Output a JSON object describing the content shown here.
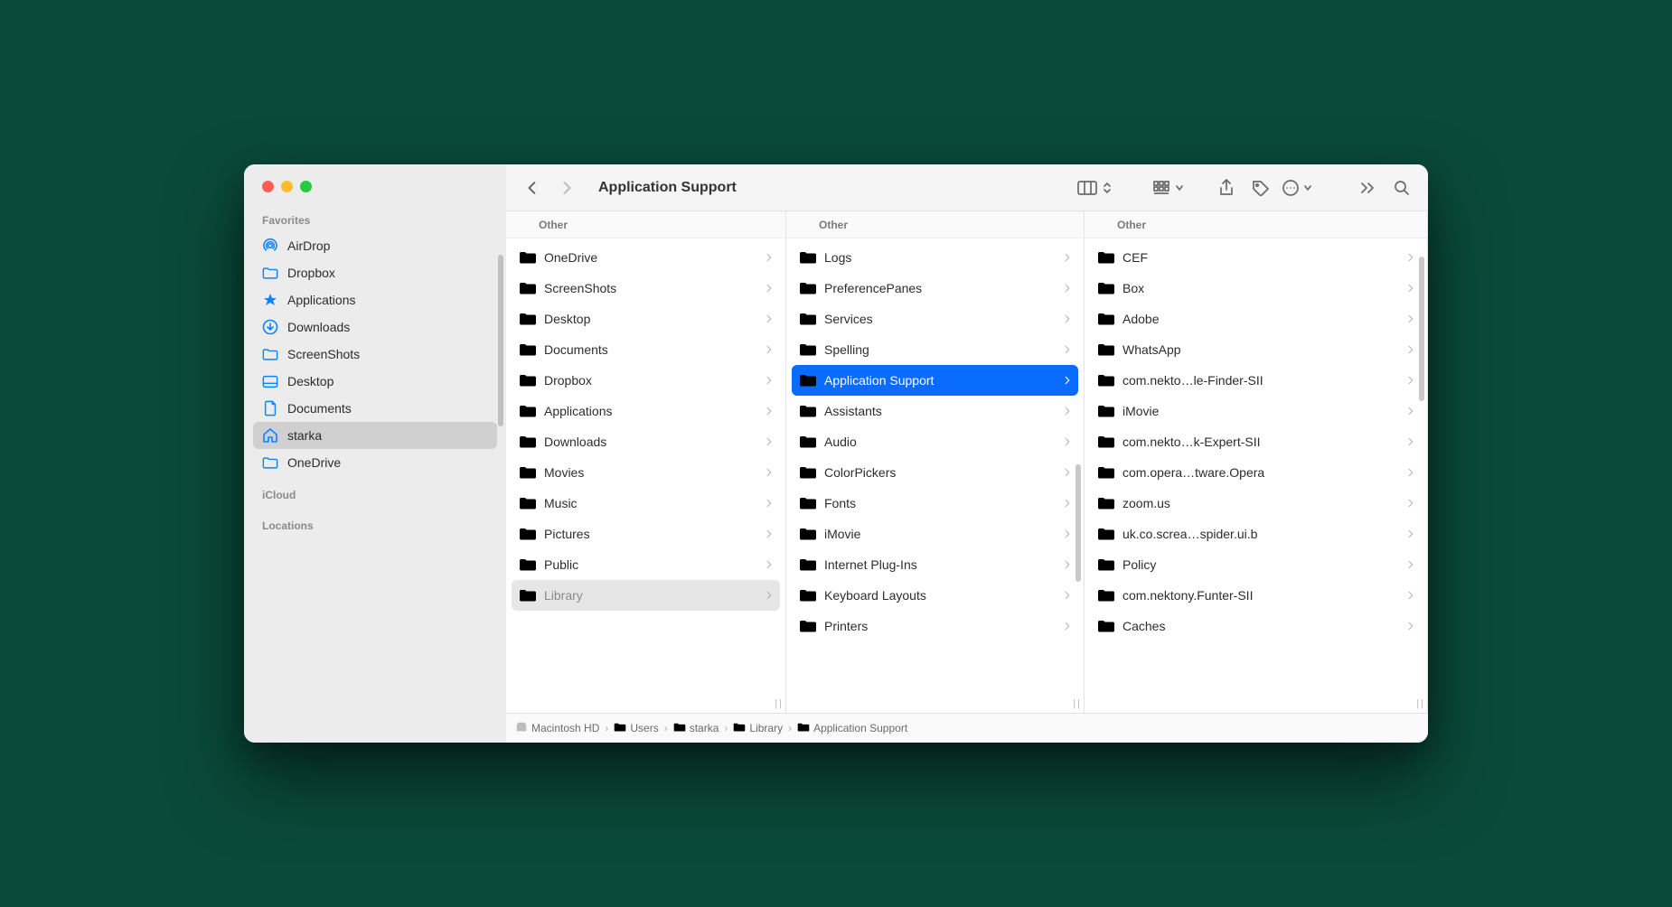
{
  "window_title": "Application Support",
  "sidebar": {
    "sections": {
      "favorites": {
        "title": "Favorites",
        "items": [
          {
            "icon": "airdrop",
            "label": "AirDrop"
          },
          {
            "icon": "folder",
            "label": "Dropbox"
          },
          {
            "icon": "app",
            "label": "Applications"
          },
          {
            "icon": "download",
            "label": "Downloads"
          },
          {
            "icon": "folder",
            "label": "ScreenShots"
          },
          {
            "icon": "desktop",
            "label": "Desktop"
          },
          {
            "icon": "doc",
            "label": "Documents"
          },
          {
            "icon": "home",
            "label": "starka",
            "selected": true
          },
          {
            "icon": "folder",
            "label": "OneDrive"
          }
        ]
      },
      "icloud": {
        "title": "iCloud"
      },
      "locations": {
        "title": "Locations"
      }
    }
  },
  "columns": [
    {
      "header": "Other",
      "items": [
        {
          "name": "OneDrive"
        },
        {
          "name": "ScreenShots"
        },
        {
          "name": "Desktop"
        },
        {
          "name": "Documents"
        },
        {
          "name": "Dropbox"
        },
        {
          "name": "Applications"
        },
        {
          "name": "Downloads"
        },
        {
          "name": "Movies"
        },
        {
          "name": "Music"
        },
        {
          "name": "Pictures"
        },
        {
          "name": "Public"
        },
        {
          "name": "Library",
          "selected": "gray"
        }
      ]
    },
    {
      "header": "Other",
      "items": [
        {
          "name": "Logs"
        },
        {
          "name": "PreferencePanes"
        },
        {
          "name": "Services"
        },
        {
          "name": "Spelling"
        },
        {
          "name": "Application Support",
          "selected": "blue"
        },
        {
          "name": "Assistants"
        },
        {
          "name": "Audio"
        },
        {
          "name": "ColorPickers"
        },
        {
          "name": "Fonts"
        },
        {
          "name": "iMovie"
        },
        {
          "name": "Internet Plug-Ins"
        },
        {
          "name": "Keyboard Layouts"
        },
        {
          "name": "Printers"
        }
      ]
    },
    {
      "header": "Other",
      "items": [
        {
          "name": "CEF"
        },
        {
          "name": "Box"
        },
        {
          "name": "Adobe"
        },
        {
          "name": "WhatsApp"
        },
        {
          "name": "com.nekto…le-Finder-SII"
        },
        {
          "name": "iMovie"
        },
        {
          "name": "com.nekto…k-Expert-SII"
        },
        {
          "name": "com.opera…tware.Opera"
        },
        {
          "name": "zoom.us"
        },
        {
          "name": "uk.co.screa…spider.ui.b"
        },
        {
          "name": "Policy"
        },
        {
          "name": "com.nektony.Funter-SII"
        },
        {
          "name": "Caches"
        }
      ]
    }
  ],
  "pathbar": [
    {
      "icon": "disk",
      "label": "Macintosh HD"
    },
    {
      "icon": "folder",
      "label": "Users"
    },
    {
      "icon": "folder",
      "label": "starka"
    },
    {
      "icon": "folder",
      "label": "Library"
    },
    {
      "icon": "folder",
      "label": "Application Support"
    }
  ]
}
